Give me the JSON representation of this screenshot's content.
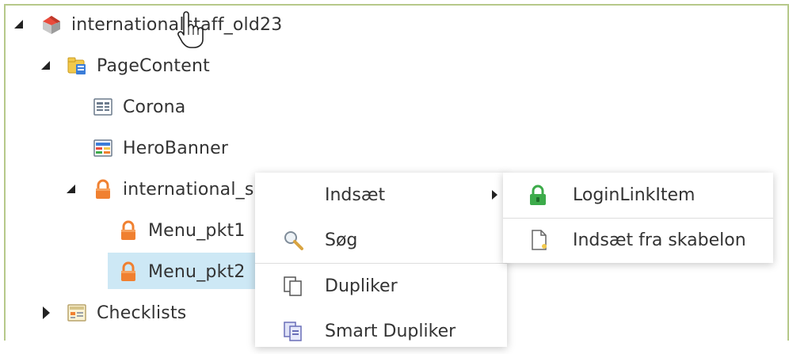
{
  "tree": {
    "root": {
      "label": "internationalstaff_old23",
      "icon": "site-icon"
    },
    "page_content": {
      "label": "PageContent",
      "icon": "folder-icon"
    },
    "corona": {
      "label": "Corona",
      "icon": "document-icon"
    },
    "hero_banner": {
      "label": "HeroBanner",
      "icon": "banner-icon"
    },
    "international_s": {
      "label": "international_s",
      "icon": "lock-icon"
    },
    "menu_pkt1": {
      "label": "Menu_pkt1",
      "icon": "lock-icon"
    },
    "menu_pkt2": {
      "label": "Menu_pkt2",
      "icon": "lock-icon",
      "selected": true
    },
    "checklists": {
      "label": "Checklists",
      "icon": "list-icon"
    }
  },
  "context_menu": {
    "items": [
      {
        "label": "Indsæt",
        "icon": "",
        "has_submenu": true
      },
      {
        "label": "Søg",
        "icon": "search-icon"
      },
      {
        "label": "Dupliker",
        "icon": "duplicate-icon"
      },
      {
        "label": "Smart Dupliker",
        "icon": "smart-duplicate-icon"
      }
    ]
  },
  "submenu": {
    "items": [
      {
        "label": "LoginLinkItem",
        "icon": "green-lock-icon"
      },
      {
        "label": "Indsæt fra skabelon",
        "icon": "template-icon"
      }
    ]
  },
  "colors": {
    "selection": "#cde8f5",
    "frame_border": "#b6c98a",
    "lock_orange": "#f08030",
    "lock_green": "#3cab4a"
  }
}
